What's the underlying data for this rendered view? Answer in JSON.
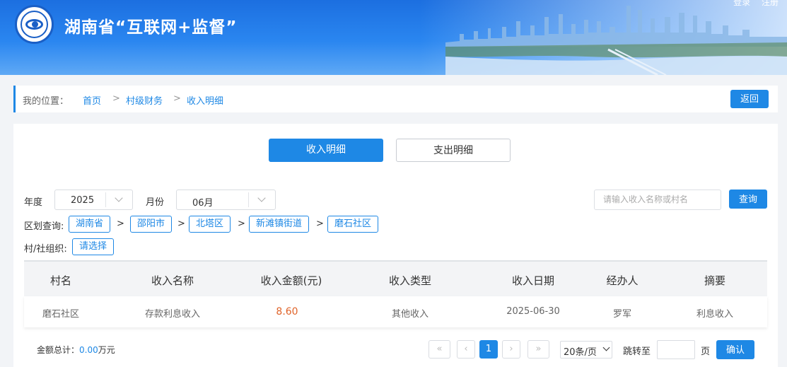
{
  "header": {
    "title": "湖南省“互联网+监督”",
    "top_links": [
      "登录",
      "注册"
    ]
  },
  "breadcrumb": {
    "label": "我的位置：",
    "items": [
      "首页",
      "村级财务",
      "收入明细"
    ],
    "separator": ">",
    "back_label": "返回"
  },
  "tabs": [
    {
      "label": "收入明细",
      "active": true
    },
    {
      "label": "支出明细",
      "active": false
    }
  ],
  "filters": {
    "year_label": "年度",
    "year_value": "2025",
    "month_label": "月份",
    "month_value": "06月",
    "search_placeholder": "请输入收入名称或村名",
    "search_button": "查询",
    "region_label": "区划查询:",
    "region_path": [
      "湖南省",
      "邵阳市",
      "北塔区",
      "新滩镇街道",
      "磨石社区"
    ],
    "org_label": "村/社组织:",
    "org_placeholder": "请选择"
  },
  "table": {
    "columns": [
      "村名",
      "收入名称",
      "收入金额(元)",
      "收入类型",
      "收入日期",
      "经办人",
      "摘要"
    ],
    "rows": [
      [
        "磨石社区",
        "存款利息收入",
        "8.60",
        "其他收入",
        "2025-06-30",
        "罗军",
        "利息收入"
      ]
    ]
  },
  "footer": {
    "total_label": "金额总计：",
    "total_value": "0.00",
    "total_unit": "万元",
    "pagination": {
      "first": "«",
      "prev": "‹",
      "current": "1",
      "next": "›",
      "last": "»",
      "per_page": "20条/页",
      "jump_label": "跳转至",
      "page_unit": "页",
      "confirm": "确认"
    }
  },
  "colors": {
    "accent": "#1e88e5",
    "amount": "#e0642a"
  }
}
